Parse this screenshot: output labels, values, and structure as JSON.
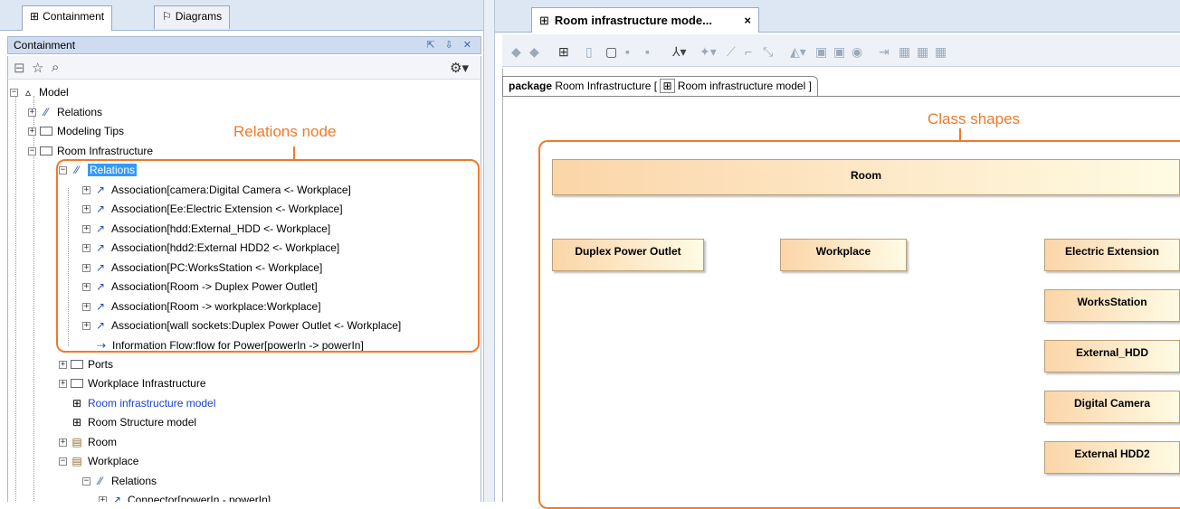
{
  "left_tabs": [
    {
      "label": "Containment",
      "active": true
    },
    {
      "label": "Diagrams",
      "active": false
    }
  ],
  "containment_panel": {
    "title": "Containment"
  },
  "tree": [
    {
      "label": "Model",
      "depth": 0
    },
    {
      "label": "Relations",
      "depth": 1
    },
    {
      "label": "Modeling Tips",
      "depth": 1
    },
    {
      "label": "Room Infrastructure",
      "depth": 1
    },
    {
      "label": "Relations",
      "depth": 2,
      "selected": true
    },
    {
      "label": "Association[camera:Digital Camera <- Workplace]",
      "depth": 3
    },
    {
      "label": "Association[Ee:Electric Extension <- Workplace]",
      "depth": 3
    },
    {
      "label": "Association[hdd:External_HDD <- Workplace]",
      "depth": 3
    },
    {
      "label": "Association[hdd2:External HDD2 <- Workplace]",
      "depth": 3
    },
    {
      "label": "Association[PC:WorksStation <- Workplace]",
      "depth": 3
    },
    {
      "label": "Association[Room -> Duplex Power Outlet]",
      "depth": 3
    },
    {
      "label": "Association[Room -> workplace:Workplace]",
      "depth": 3
    },
    {
      "label": "Association[wall sockets:Duplex Power Outlet <- Workplace]",
      "depth": 3
    },
    {
      "label": "Information Flow:flow for Power[powerIn -> powerIn]",
      "depth": 3
    },
    {
      "label": "Ports",
      "depth": 2
    },
    {
      "label": "Workplace Infrastructure",
      "depth": 2
    },
    {
      "label": "Room infrastructure model",
      "depth": 2,
      "link": true
    },
    {
      "label": "Room Structure model",
      "depth": 2
    },
    {
      "label": "Room",
      "depth": 2
    },
    {
      "label": "Workplace",
      "depth": 2
    },
    {
      "label": "Relations",
      "depth": 3
    },
    {
      "label": "Connector[powerIn - powerIn]",
      "depth": 4
    }
  ],
  "annotations": {
    "relations_node": "Relations node",
    "class_shapes": "Class shapes"
  },
  "diagram_tab": {
    "title": "Room infrastructure mode...",
    "close": "×"
  },
  "package_header": {
    "keyword": "package",
    "name": "Room Infrastructure",
    "diagram_ref": "Room infrastructure model",
    "bracket_open": "[",
    "bracket_close": "]"
  },
  "classes": {
    "room": "Room",
    "duplex": "Duplex Power Outlet",
    "workplace": "Workplace",
    "electric": "Electric Extension",
    "workstation": "WorksStation",
    "hdd": "External_HDD",
    "camera": "Digital Camera",
    "hdd2": "External HDD2"
  },
  "colors": {
    "accent": "#ef7a2a",
    "selection": "#3399ff",
    "class_fill_start": "#fbd5a8",
    "class_fill_end": "#fffbe4"
  }
}
